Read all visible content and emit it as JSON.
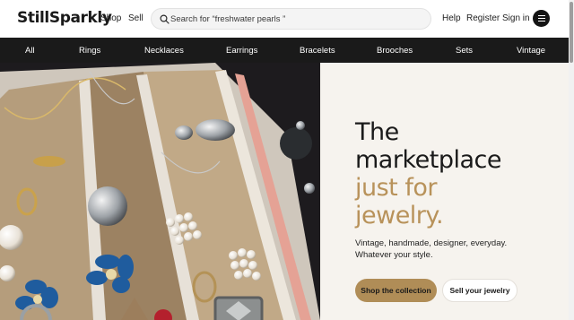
{
  "header": {
    "logo": "StillSparkly",
    "shop": "Shop",
    "sell": "Sell",
    "search_placeholder": "Search for “freshwater pearls ”",
    "help": "Help",
    "register": "Register",
    "sign_in": "Sign in"
  },
  "categories": [
    "All",
    "Rings",
    "Necklaces",
    "Earrings",
    "Bracelets",
    "Brooches",
    "Sets",
    "Vintage"
  ],
  "hero": {
    "headline_dark_1": "The",
    "headline_dark_2": "marketplace",
    "headline_gold_1": "just for",
    "headline_gold_2": "jewelry.",
    "subtitle_1": "Vintage, handmade, designer, everyday.",
    "subtitle_2": "Whatever your style.",
    "primary_button": "Shop the collection",
    "secondary_button": "Sell your jewelry"
  },
  "colors": {
    "accent_gold": "#b8925a",
    "button_gold": "#b08d57",
    "category_bar": "#1a1a1a",
    "hero_background": "#f6f3ee"
  },
  "icons": [
    "search-icon",
    "menu-icon"
  ]
}
